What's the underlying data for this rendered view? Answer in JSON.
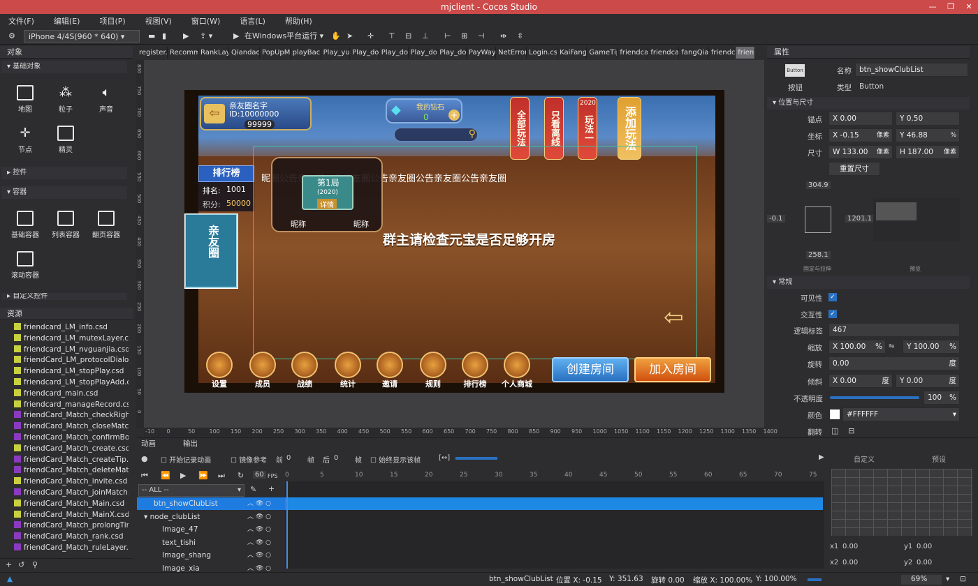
{
  "window": {
    "title": "mjclient - Cocos Studio",
    "min": "—",
    "max": "❐",
    "close": "✕"
  },
  "menu": [
    "文件(F)",
    "编辑(E)",
    "项目(P)",
    "视图(V)",
    "窗口(W)",
    "语言(L)",
    "帮助(H)"
  ],
  "toolbar": {
    "device": "iPhone 4/4S(960 * 640)",
    "run_target": "在Windows平台运行"
  },
  "objects_panel": {
    "title": "对象",
    "sections": {
      "basic": "基础对象",
      "controls": "控件",
      "containers": "容器",
      "custom": "自定义控件"
    },
    "basic_items": [
      "地图",
      "粒子",
      "声音",
      "节点",
      "精灵"
    ],
    "container_items": [
      "基础容器",
      "列表容器",
      "翻页容器",
      "滚动容器"
    ]
  },
  "resources_panel": {
    "title": "资源",
    "items": [
      {
        "name": "friendcard_LM_info.csd",
        "color": "#c8d040"
      },
      {
        "name": "friendcard_LM_mutexLayer.cs",
        "color": "#c8d040"
      },
      {
        "name": "friendcard_LM_nvguanjia.csd",
        "color": "#c8d040"
      },
      {
        "name": "friendCard_LM_protocolDialog",
        "color": "#c8d040"
      },
      {
        "name": "friendcard_LM_stopPlay.csd",
        "color": "#c8d040"
      },
      {
        "name": "friendcard_LM_stopPlayAdd.c",
        "color": "#c8d040"
      },
      {
        "name": "friendcard_main.csd",
        "color": "#c8d040"
      },
      {
        "name": "friendcard_manageRecord.csd",
        "color": "#c8d040"
      },
      {
        "name": "friendCard_Match_checkRight.",
        "color": "#8a3ac0"
      },
      {
        "name": "friendCard_Match_closeMatch",
        "color": "#8a3ac0"
      },
      {
        "name": "friendCard_Match_confirmBox",
        "color": "#8a3ac0"
      },
      {
        "name": "friendCard_Match_create.csd",
        "color": "#c8d040"
      },
      {
        "name": "friendCard_Match_createTip.c",
        "color": "#8a3ac0"
      },
      {
        "name": "friendCard_Match_deleteMatc",
        "color": "#8a3ac0"
      },
      {
        "name": "friendCard_Match_invite.csd",
        "color": "#c8d040"
      },
      {
        "name": "friendCard_Match_joinMatch.c",
        "color": "#8a3ac0"
      },
      {
        "name": "friendCard_Match_Main.csd",
        "color": "#c8d040"
      },
      {
        "name": "friendCard_Match_MainX.csd",
        "color": "#c8d040"
      },
      {
        "name": "friendCard_Match_prolongTim",
        "color": "#8a3ac0"
      },
      {
        "name": "friendCard_Match_rank.csd",
        "color": "#8a3ac0"
      },
      {
        "name": "friendCard_Match_ruleLayer.c",
        "color": "#8a3ac0"
      }
    ]
  },
  "tabs": [
    "register.",
    "Recomm",
    "RankLay",
    "Qiandao",
    "PopUpM",
    "playBack",
    "Play_yu",
    "Play_do",
    "Play_do",
    "Play_do",
    "Play_do",
    "PayWay",
    "NetError",
    "Login.cs",
    "KaiFang",
    "GameTip",
    "friendca",
    "friendca",
    "fangQia",
    "friendc",
    "frien"
  ],
  "ruler_h": [
    "-10",
    "0",
    "50",
    "100",
    "150",
    "200",
    "250",
    "300",
    "350",
    "400",
    "450",
    "500",
    "550",
    "600",
    "650",
    "700",
    "750",
    "800",
    "850",
    "900",
    "950",
    "1000",
    "1050",
    "1100",
    "1150",
    "1200",
    "1250",
    "1300",
    "1350",
    "1400"
  ],
  "ruler_v": [
    "800",
    "750",
    "700",
    "650",
    "600",
    "550",
    "500",
    "450",
    "400",
    "350",
    "300",
    "250",
    "200",
    "150",
    "100",
    "50",
    "0"
  ],
  "game": {
    "club_name": "亲友圈名字",
    "club_id": "ID:10000000",
    "gold": "99999",
    "diamond_label": "我的钻石",
    "diamond_value": "0",
    "lanterns": [
      "全部玩法",
      "只看离线",
      "玩法一",
      "添加玩法"
    ],
    "lantern_top": "2020",
    "rank_title": "排行榜",
    "rank_label": "排名:",
    "rank_value": "1001",
    "score_label": "积分:",
    "score_value": "50000",
    "notice": "昵圈公告亲友圈公告亲友圈公告亲友圈公告亲友圈公告亲友圈",
    "table_round": "第1局",
    "table_year": "(2020)",
    "detail": "详情",
    "nickname": "昵称",
    "check_msg": "群主请检查元宝是否足够开房",
    "club_btn": "亲友圈",
    "bottom": [
      "设置",
      "成员",
      "战绩",
      "统计",
      "邀请",
      "规则",
      "排行榜",
      "个人商城"
    ],
    "create_btn": "创建房间",
    "join_btn": "加入房间"
  },
  "properties": {
    "title": "属性",
    "type_icon": "Button",
    "type_icon_label": "按钮",
    "name_label": "名称",
    "name": "btn_showClubList",
    "type_label": "类型",
    "type": "Button",
    "pos_section": "位置与尺寸",
    "anchor_label": "锚点",
    "anchor_x": "X  0.00",
    "anchor_y": "Y  0.50",
    "coord_label": "坐标",
    "coord_x": "X  -0.15",
    "coord_x_unit": "像素",
    "coord_y": "Y  46.88",
    "coord_y_unit": "%",
    "size_label": "尺寸",
    "size_w": "W  133.00",
    "size_w_unit": "像素",
    "size_h": "H  187.00",
    "size_h_unit": "像素",
    "reset_size": "重置尺寸",
    "margin_top": "304.9",
    "margin_left": "-0.1",
    "margin_right": "1201.1",
    "margin_bottom": "258.1",
    "layout_caption": "固定与拉伸",
    "preview_caption": "预览",
    "general_section": "常规",
    "visible_label": "可见性",
    "interact_label": "交互性",
    "tag_label": "逻辑标签",
    "tag": "467",
    "scale_label": "缩放",
    "scale_x": "X  100.00",
    "scale_x_unit": "%",
    "scale_y": "Y  100.00",
    "scale_y_unit": "%",
    "rotate_label": "旋转",
    "rotate": "0.00",
    "rotate_unit": "度",
    "skew_label": "倾斜",
    "skew_x": "X  0.00",
    "skew_x_unit": "度",
    "skew_y": "Y  0.00",
    "skew_y_unit": "度",
    "opacity_label": "不透明度",
    "opacity": "100",
    "opacity_unit": "%",
    "color_label": "颜色",
    "color": "#FFFFFF",
    "flip_label": "翻转"
  },
  "timeline": {
    "tab_anim": "动画",
    "tab_output": "输出",
    "start_record": "开始记录动画",
    "mirror": "镜像参考",
    "prev_label": "前",
    "prev_val": "0",
    "frame_unit": "帧",
    "next_label": "后",
    "next_val": "0",
    "next_unit": "帧",
    "always_show": "始终显示该帧",
    "fps": "60",
    "fps_label": "FPS",
    "filter": "-- ALL --",
    "frames": [
      "0",
      "5",
      "10",
      "15",
      "20",
      "25",
      "30",
      "35",
      "40",
      "45",
      "50",
      "55",
      "60",
      "65",
      "70",
      "75"
    ],
    "nodes": [
      "btn_showClubList",
      "node_clubList",
      "Image_47",
      "text_tishi",
      "Image_shang",
      "Image_xia"
    ],
    "curve_tab_custom": "自定义",
    "curve_tab_preset": "预设",
    "x1_label": "x1",
    "x1": "0.00",
    "y1_label": "y1",
    "y1": "0.00",
    "x2_label": "x2",
    "x2": "0.00",
    "y2_label": "y2",
    "y2": "0.00"
  },
  "status": {
    "node": "btn_showClubList",
    "pos_label": "位置 X: -0.15",
    "pos_y": "Y: 351.63",
    "rot": "旋转 0.00",
    "scale": "缩放 X: 100.00%",
    "scale_y": "Y: 100.00%",
    "zoom": "69%"
  },
  "colors": {
    "title_bar": "#cc4a4a",
    "selection": "#1e7be0",
    "timeline_bar": "#1e88e5"
  }
}
